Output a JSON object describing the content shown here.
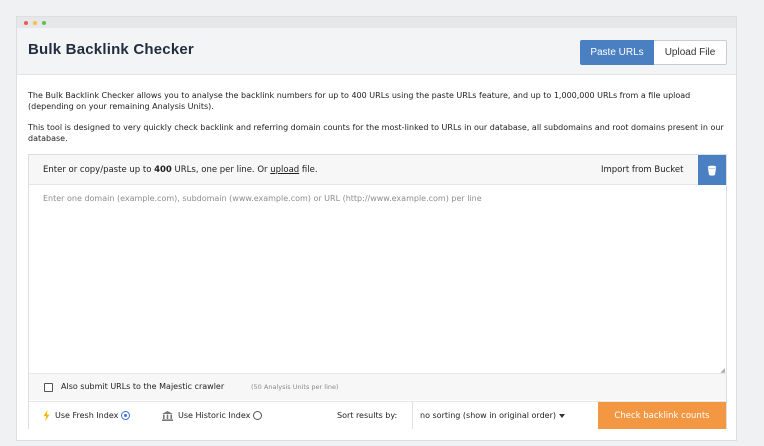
{
  "app": {
    "title": "Bulk Backlink Checker",
    "tabs": [
      {
        "label": "Paste URLs",
        "active": true
      },
      {
        "label": "Upload File",
        "active": false
      }
    ]
  },
  "description": {
    "paragraph1": "The Bulk Backlink Checker allows you to analyse the backlink numbers for up to 400 URLs using the paste URLs feature, and up to 1,000,000 URLs from a file upload (depending on your remaining Analysis Units).",
    "paragraph2": "This tool is designed to very quickly check backlink and referring domain counts for the most-linked to URLs in our database, all subdomains and root domains present in our database."
  },
  "input_panel": {
    "instruction_prefix": "Enter or copy/paste up to ",
    "instruction_count": "400",
    "instruction_middle": " URLs, one per line. Or ",
    "instruction_link": "upload",
    "instruction_suffix": " file.",
    "import_label": "Import from Bucket",
    "textarea_placeholder": "Enter one domain (example.com), subdomain (www.example.com) or URL (http://www.example.com) per line",
    "textarea_value": ""
  },
  "crawler": {
    "label": "Also submit URLs to the Majestic crawler",
    "note": "(50 Analysis Units per line)",
    "checked": false
  },
  "options": {
    "fresh_label": "Use Fresh Index",
    "historic_label": "Use Historic Index",
    "selected_index": "fresh",
    "sort_label": "Sort results by:",
    "sort_value": "no sorting (show in original order)",
    "submit_label": "Check backlink counts"
  },
  "colors": {
    "accent_blue": "#4a7fc1",
    "submit_orange": "#f39742",
    "fresh_icon": "#f5b800"
  },
  "icons": {
    "bucket": "bucket-icon",
    "fresh": "lightning-icon",
    "historic": "bank-icon",
    "sort": "chevron-down-icon"
  }
}
